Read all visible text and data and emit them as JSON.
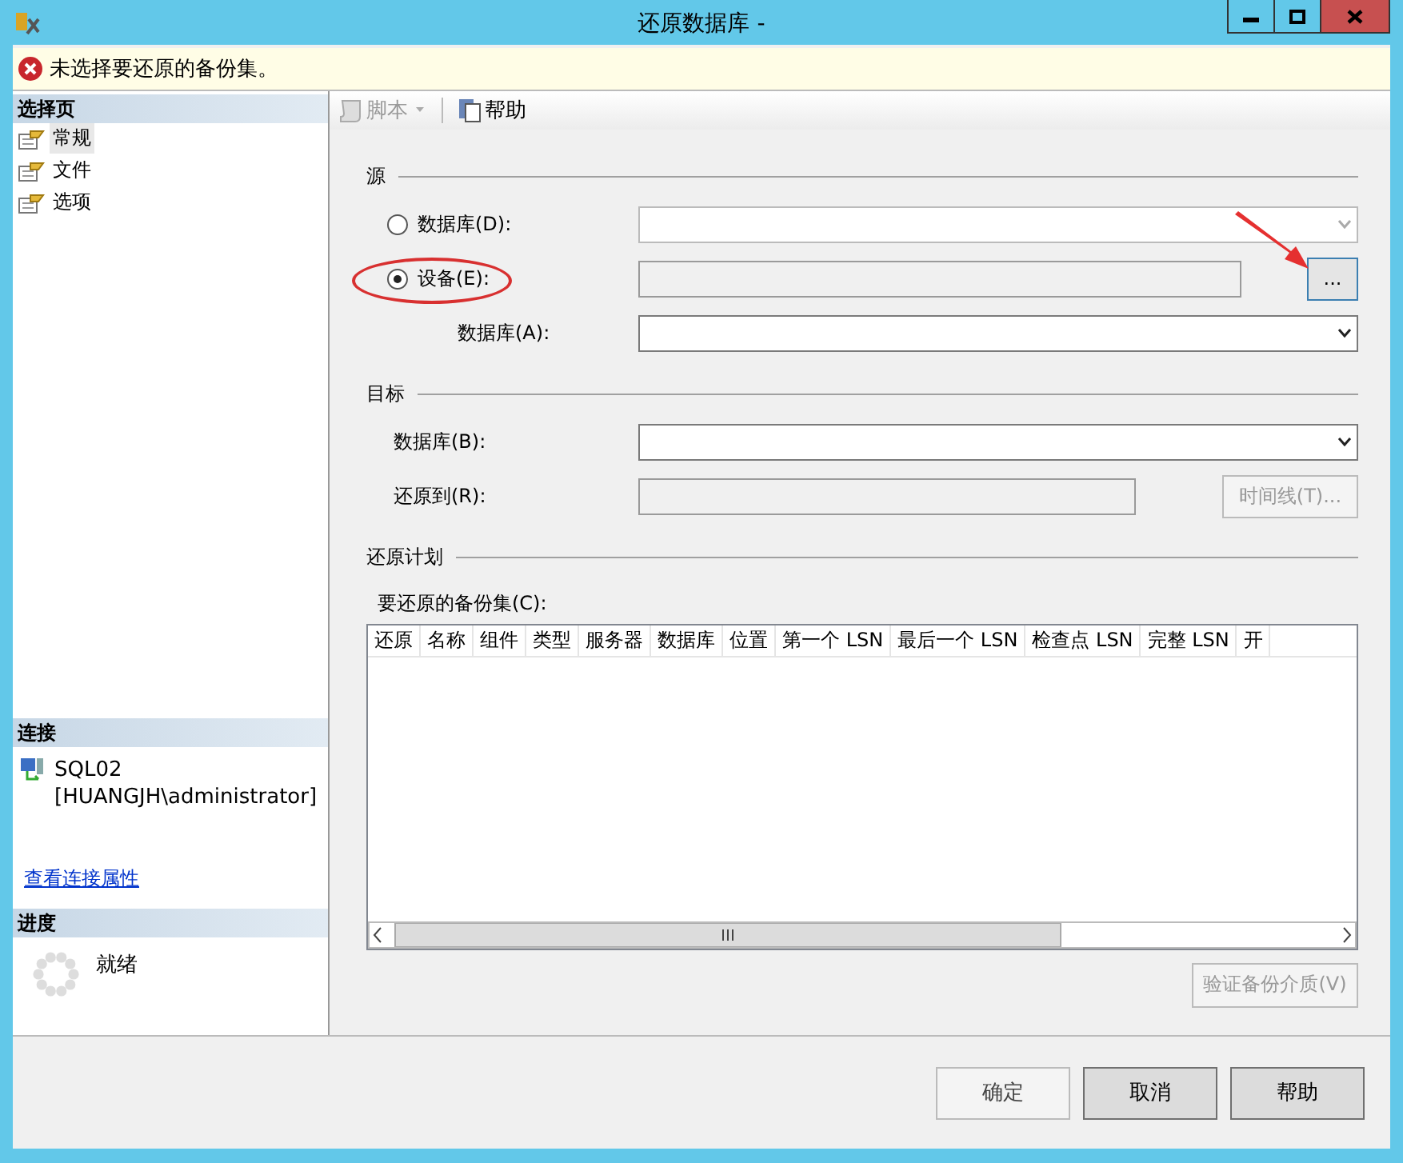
{
  "window": {
    "title": "还原数据库 -"
  },
  "error_bar": {
    "message": "未选择要还原的备份集。"
  },
  "toolbar": [
    {
      "kind": "script",
      "label": "脚本",
      "disabled": true
    },
    {
      "kind": "help",
      "label": "帮助",
      "disabled": false
    }
  ],
  "sidebar": {
    "pages_header": "选择页",
    "items": [
      {
        "label": "常规",
        "selected": true
      },
      {
        "label": "文件",
        "selected": false
      },
      {
        "label": "选项",
        "selected": false
      }
    ],
    "connection_header": "连接",
    "server": "SQL02",
    "user": "[HUANGJH\\administrator]",
    "link": "查看连接属性",
    "progress_header": "进度",
    "progress_status": "就绪"
  },
  "source": {
    "legend": "源",
    "rows": [
      {
        "kind": "radio",
        "label": "数据库(D):",
        "selected": false,
        "field": {
          "kind": "combo",
          "disabled": true
        }
      },
      {
        "kind": "radio",
        "label": "设备(E):",
        "selected": true,
        "field": {
          "kind": "text",
          "disabled": true
        },
        "button": {
          "label": "...",
          "disabled": false
        }
      },
      {
        "kind": "sublabel",
        "label": "数据库(A):",
        "field": {
          "kind": "combo",
          "disabled": false
        }
      }
    ]
  },
  "destination": {
    "legend": "目标",
    "rows": [
      {
        "kind": "label",
        "label": "数据库(B):",
        "field": {
          "kind": "combo",
          "disabled": false
        }
      },
      {
        "kind": "label",
        "label": "还原到(R):",
        "field": {
          "kind": "text",
          "disabled": true
        },
        "button": {
          "label": "时间线(T)...",
          "disabled": true
        }
      }
    ]
  },
  "plan": {
    "legend": "还原计划",
    "table_label": "要还原的备份集(C):",
    "columns": [
      "还原",
      "名称",
      "组件",
      "类型",
      "服务器",
      "数据库",
      "位置",
      "第一个 LSN",
      "最后一个 LSN",
      "检查点 LSN",
      "完整 LSN",
      "开"
    ],
    "verify_button": {
      "label": "验证备份介质(V)",
      "disabled": true
    }
  },
  "buttons": [
    {
      "label": "确定",
      "disabled": true
    },
    {
      "label": "取消",
      "disabled": false
    },
    {
      "label": "帮助",
      "disabled": false
    }
  ]
}
